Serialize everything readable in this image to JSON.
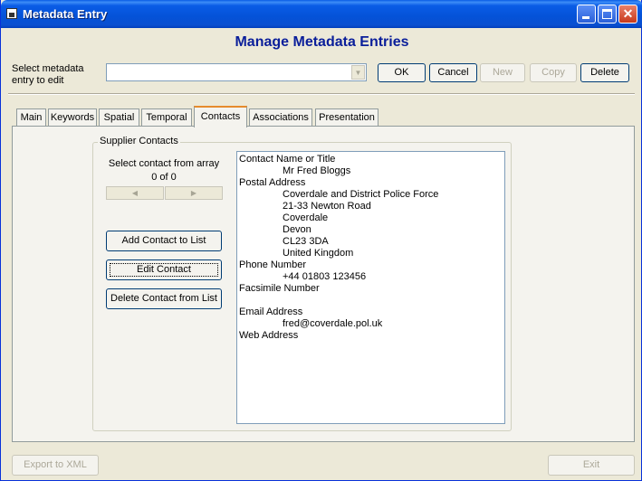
{
  "window": {
    "title": "Metadata Entry"
  },
  "heading": "Manage Metadata Entries",
  "select_label": "Select metadata entry to edit",
  "combo": {
    "value": ""
  },
  "top_buttons": {
    "ok": "OK",
    "cancel": "Cancel",
    "new": "New",
    "copy": "Copy",
    "delete": "Delete"
  },
  "tabs": [
    "Main",
    "Keywords",
    "Spatial",
    "Temporal",
    "Contacts",
    "Associations",
    "Presentation"
  ],
  "active_tab": "Contacts",
  "contacts": {
    "group_label": "Supplier Contacts",
    "array_label": "Select contact from array",
    "count": "0 of 0",
    "add_button": "Add Contact to List",
    "edit_button": "Edit Contact",
    "delete_button": "Delete Contact from List",
    "details": [
      {
        "text": "Contact Name or Title",
        "indent": false
      },
      {
        "text": "Mr Fred Bloggs",
        "indent": true
      },
      {
        "text": "Postal Address",
        "indent": false
      },
      {
        "text": "Coverdale and District Police Force",
        "indent": true
      },
      {
        "text": "21-33 Newton Road",
        "indent": true
      },
      {
        "text": "Coverdale",
        "indent": true
      },
      {
        "text": "Devon",
        "indent": true
      },
      {
        "text": "CL23 3DA",
        "indent": true
      },
      {
        "text": "United Kingdom",
        "indent": true
      },
      {
        "text": "Phone Number",
        "indent": false
      },
      {
        "text": "+44 01803 123456",
        "indent": true
      },
      {
        "text": "Facsimile Number",
        "indent": false
      },
      {
        "text": "",
        "indent": false
      },
      {
        "text": "Email Address",
        "indent": false
      },
      {
        "text": "fred@coverdale.pol.uk",
        "indent": true
      },
      {
        "text": "Web Address",
        "indent": false
      }
    ]
  },
  "bottom_buttons": {
    "export": "Export to XML",
    "exit": "Exit"
  },
  "colors": {
    "title_bar": "#0a5ce6",
    "heading": "#0a1e9a",
    "active_tab_accent": "#e68b2c",
    "window_bg": "#ece9d8"
  }
}
